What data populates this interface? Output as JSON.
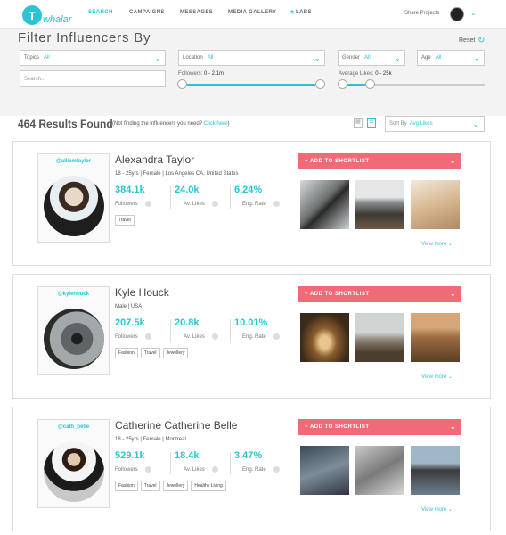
{
  "nav": {
    "logo_letter": "T",
    "logo_text": "whalar",
    "items": [
      "SEARCH",
      "CAMPAIGNS",
      "MESSAGES",
      "MEDIA GALLERY",
      "LABS"
    ],
    "labs_icon": "⚗",
    "share": "Share Projects",
    "chevron": "⌄"
  },
  "filters": {
    "title": "Filter Influencers By",
    "reset": "Reset",
    "reset_icon": "↻",
    "topics": {
      "label": "Topics",
      "value": "All"
    },
    "location": {
      "label": "Location",
      "value": "All"
    },
    "gender": {
      "label": "Gender",
      "value": "All"
    },
    "age": {
      "label": "Age",
      "value": "All"
    },
    "search_placeholder": "Search...",
    "followers": {
      "label": "Followers:",
      "range": "0 - 2.1m",
      "min": 0,
      "max": 1
    },
    "likes": {
      "label": "Average Likes:",
      "range": "0 - 25k",
      "min": 0,
      "max": 0.25
    }
  },
  "results": {
    "count_text": "464 Results Found",
    "note": "(Not finding the influencers you need?",
    "link": "Click here",
    "close": ")",
    "sort_label": "Sort By",
    "sort_value": "Avg Likes",
    "grid_icon": "▦",
    "list_icon": "☰"
  },
  "card_labels": {
    "followers": "Followers",
    "likes": "Av. Likes",
    "eng": "Eng. Rate",
    "add": "+ ADD TO SHORTLIST",
    "drop": "⌄",
    "view_more": "View more ⌄"
  },
  "influencers": [
    {
      "handle": "@alliemtaylor",
      "name": "Alexandra Taylor",
      "meta": "18 - 25yrs | Female | Los Angeles CA, United States",
      "followers": "384.1k",
      "likes": "24.0k",
      "eng": "6.24%",
      "tags": [
        "Travel"
      ]
    },
    {
      "handle": "@kylehouck",
      "name": "Kyle Houck",
      "meta": "Male | USA",
      "followers": "207.5k",
      "likes": "20.8k",
      "eng": "10.01%",
      "tags": [
        "Fashion",
        "Travel",
        "Jewellery"
      ]
    },
    {
      "handle": "@cath_belle",
      "name": "Catherine Catherine Belle",
      "meta": "18 - 25yrs | Female | Montreal",
      "followers": "529.1k",
      "likes": "18.4k",
      "eng": "3.47%",
      "tags": [
        "Fashion",
        "Travel",
        "Jewellery",
        "Healthy Living"
      ]
    }
  ],
  "colors": {
    "accent": "#2bc4d0",
    "button": "#f06b78"
  }
}
